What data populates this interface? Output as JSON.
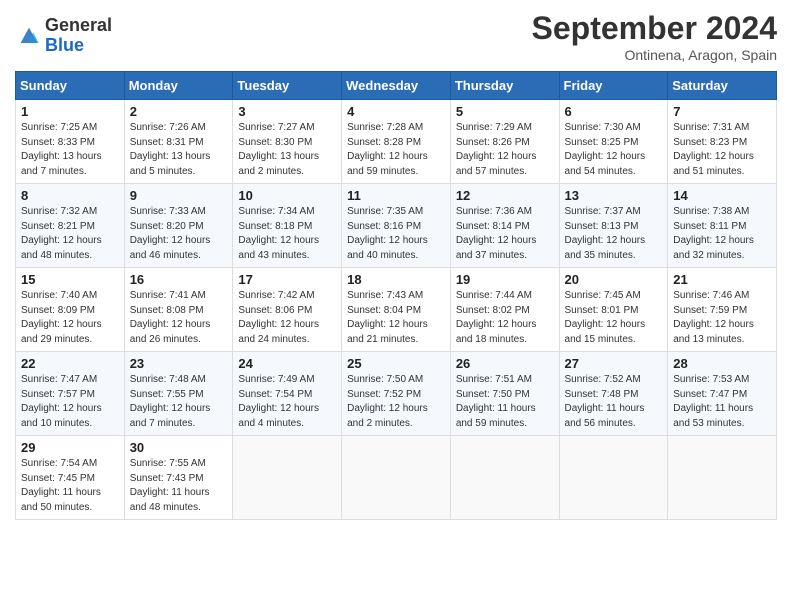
{
  "header": {
    "logo_general": "General",
    "logo_blue": "Blue",
    "month_title": "September 2024",
    "location": "Ontinena, Aragon, Spain"
  },
  "weekdays": [
    "Sunday",
    "Monday",
    "Tuesday",
    "Wednesday",
    "Thursday",
    "Friday",
    "Saturday"
  ],
  "weeks": [
    [
      {
        "day": "1",
        "info": "Sunrise: 7:25 AM\nSunset: 8:33 PM\nDaylight: 13 hours\nand 7 minutes."
      },
      {
        "day": "2",
        "info": "Sunrise: 7:26 AM\nSunset: 8:31 PM\nDaylight: 13 hours\nand 5 minutes."
      },
      {
        "day": "3",
        "info": "Sunrise: 7:27 AM\nSunset: 8:30 PM\nDaylight: 13 hours\nand 2 minutes."
      },
      {
        "day": "4",
        "info": "Sunrise: 7:28 AM\nSunset: 8:28 PM\nDaylight: 12 hours\nand 59 minutes."
      },
      {
        "day": "5",
        "info": "Sunrise: 7:29 AM\nSunset: 8:26 PM\nDaylight: 12 hours\nand 57 minutes."
      },
      {
        "day": "6",
        "info": "Sunrise: 7:30 AM\nSunset: 8:25 PM\nDaylight: 12 hours\nand 54 minutes."
      },
      {
        "day": "7",
        "info": "Sunrise: 7:31 AM\nSunset: 8:23 PM\nDaylight: 12 hours\nand 51 minutes."
      }
    ],
    [
      {
        "day": "8",
        "info": "Sunrise: 7:32 AM\nSunset: 8:21 PM\nDaylight: 12 hours\nand 48 minutes."
      },
      {
        "day": "9",
        "info": "Sunrise: 7:33 AM\nSunset: 8:20 PM\nDaylight: 12 hours\nand 46 minutes."
      },
      {
        "day": "10",
        "info": "Sunrise: 7:34 AM\nSunset: 8:18 PM\nDaylight: 12 hours\nand 43 minutes."
      },
      {
        "day": "11",
        "info": "Sunrise: 7:35 AM\nSunset: 8:16 PM\nDaylight: 12 hours\nand 40 minutes."
      },
      {
        "day": "12",
        "info": "Sunrise: 7:36 AM\nSunset: 8:14 PM\nDaylight: 12 hours\nand 37 minutes."
      },
      {
        "day": "13",
        "info": "Sunrise: 7:37 AM\nSunset: 8:13 PM\nDaylight: 12 hours\nand 35 minutes."
      },
      {
        "day": "14",
        "info": "Sunrise: 7:38 AM\nSunset: 8:11 PM\nDaylight: 12 hours\nand 32 minutes."
      }
    ],
    [
      {
        "day": "15",
        "info": "Sunrise: 7:40 AM\nSunset: 8:09 PM\nDaylight: 12 hours\nand 29 minutes."
      },
      {
        "day": "16",
        "info": "Sunrise: 7:41 AM\nSunset: 8:08 PM\nDaylight: 12 hours\nand 26 minutes."
      },
      {
        "day": "17",
        "info": "Sunrise: 7:42 AM\nSunset: 8:06 PM\nDaylight: 12 hours\nand 24 minutes."
      },
      {
        "day": "18",
        "info": "Sunrise: 7:43 AM\nSunset: 8:04 PM\nDaylight: 12 hours\nand 21 minutes."
      },
      {
        "day": "19",
        "info": "Sunrise: 7:44 AM\nSunset: 8:02 PM\nDaylight: 12 hours\nand 18 minutes."
      },
      {
        "day": "20",
        "info": "Sunrise: 7:45 AM\nSunset: 8:01 PM\nDaylight: 12 hours\nand 15 minutes."
      },
      {
        "day": "21",
        "info": "Sunrise: 7:46 AM\nSunset: 7:59 PM\nDaylight: 12 hours\nand 13 minutes."
      }
    ],
    [
      {
        "day": "22",
        "info": "Sunrise: 7:47 AM\nSunset: 7:57 PM\nDaylight: 12 hours\nand 10 minutes."
      },
      {
        "day": "23",
        "info": "Sunrise: 7:48 AM\nSunset: 7:55 PM\nDaylight: 12 hours\nand 7 minutes."
      },
      {
        "day": "24",
        "info": "Sunrise: 7:49 AM\nSunset: 7:54 PM\nDaylight: 12 hours\nand 4 minutes."
      },
      {
        "day": "25",
        "info": "Sunrise: 7:50 AM\nSunset: 7:52 PM\nDaylight: 12 hours\nand 2 minutes."
      },
      {
        "day": "26",
        "info": "Sunrise: 7:51 AM\nSunset: 7:50 PM\nDaylight: 11 hours\nand 59 minutes."
      },
      {
        "day": "27",
        "info": "Sunrise: 7:52 AM\nSunset: 7:48 PM\nDaylight: 11 hours\nand 56 minutes."
      },
      {
        "day": "28",
        "info": "Sunrise: 7:53 AM\nSunset: 7:47 PM\nDaylight: 11 hours\nand 53 minutes."
      }
    ],
    [
      {
        "day": "29",
        "info": "Sunrise: 7:54 AM\nSunset: 7:45 PM\nDaylight: 11 hours\nand 50 minutes."
      },
      {
        "day": "30",
        "info": "Sunrise: 7:55 AM\nSunset: 7:43 PM\nDaylight: 11 hours\nand 48 minutes."
      },
      {
        "day": "",
        "info": ""
      },
      {
        "day": "",
        "info": ""
      },
      {
        "day": "",
        "info": ""
      },
      {
        "day": "",
        "info": ""
      },
      {
        "day": "",
        "info": ""
      }
    ]
  ]
}
